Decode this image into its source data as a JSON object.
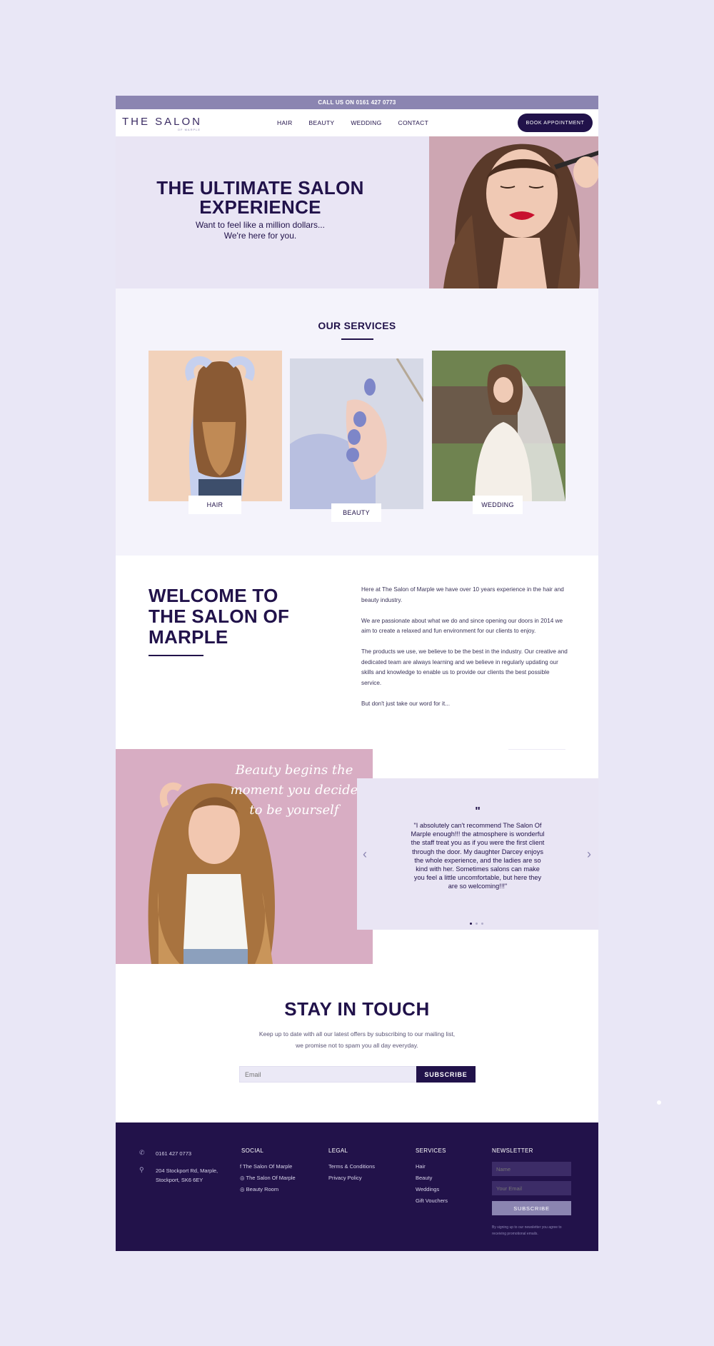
{
  "topbar": {
    "text": "CALL US ON 0161 427 0773"
  },
  "header": {
    "logo": {
      "main": "THE SALON",
      "sub": "OF MARPLE"
    },
    "nav": [
      "HAIR",
      "BEAUTY",
      "WEDDING",
      "CONTACT"
    ],
    "cta": "BOOK APPOINTMENT"
  },
  "hero": {
    "title": "THE ULTIMATE SALON EXPERIENCE",
    "subtitle_line1": "Want to feel like a million dollars...",
    "subtitle_line2": "We're here for you."
  },
  "services": {
    "title": "OUR SERVICES",
    "items": [
      {
        "label": "HAIR"
      },
      {
        "label": "BEAUTY"
      },
      {
        "label": "WEDDING"
      }
    ]
  },
  "welcome": {
    "title": "WELCOME TO THE SALON OF MARPLE",
    "paragraphs": [
      "Here at The Salon of Marple we have over 10 years experience in the hair and beauty industry.",
      "We are passionate about what we do and since opening our doors in 2014 we aim to create a relaxed and fun environment for our clients to enjoy.",
      "The products we use, we believe to be the best in the industry. Our creative and dedicated team are always learning and we believe in regularly updating our skills and knowledge to enable us to provide our clients the best possible service.",
      "But don't just take our word for it..."
    ]
  },
  "testimonial": {
    "script_line1": "Beauty begins the",
    "script_line2": "moment you decide",
    "script_line3": "to be yourself",
    "mark": "\"",
    "quote": "\"I absolutely can't recommend The Salon Of Marple enough!!! the atmosphere is wonderful the staff treat you as if you were the first client through the door. My daughter Darcey enjoys the whole experience, and the ladies are so kind with her. Sometimes salons can make you feel a little uncomfortable, but here they are so welcoming!!!\"",
    "prev": "‹",
    "next": "›",
    "slides": 3,
    "active_slide": 1
  },
  "newsletter": {
    "title": "STAY IN TOUCH",
    "line1": "Keep up to date with all our latest offers by subscribing to our mailing list,",
    "line2": "we promise not to spam you all day everyday.",
    "email_placeholder": "Email",
    "button": "SUBSCRIBE"
  },
  "footer": {
    "phone": "0161 427 0773",
    "address_line1": "204 Stockport Rd, Marple,",
    "address_line2": "Stockport,  SK6 6EY",
    "social": {
      "heading": "SOCIAL",
      "items": [
        "The Salon Of Marple",
        "The Salon Of Marple",
        "Beauty Room"
      ]
    },
    "legal": {
      "heading": "LEGAL",
      "items": [
        "Terms & Conditions",
        "Privacy Policy"
      ]
    },
    "services": {
      "heading": "SERVICES",
      "items": [
        "Hair",
        "Beauty",
        "Weddings",
        "Gift Vouchers"
      ]
    },
    "newsletter": {
      "heading": "NEWSLETTER",
      "name_placeholder": "Name",
      "email_placeholder": "Your Email",
      "button": "SUBSCRIBE",
      "disclaimer": "By signing up to our newsletter you agree to receiving promotional emails."
    }
  },
  "colors": {
    "brand": "#21124a",
    "accent": "#8b85b1",
    "page_bg": "#e9e7f6"
  }
}
